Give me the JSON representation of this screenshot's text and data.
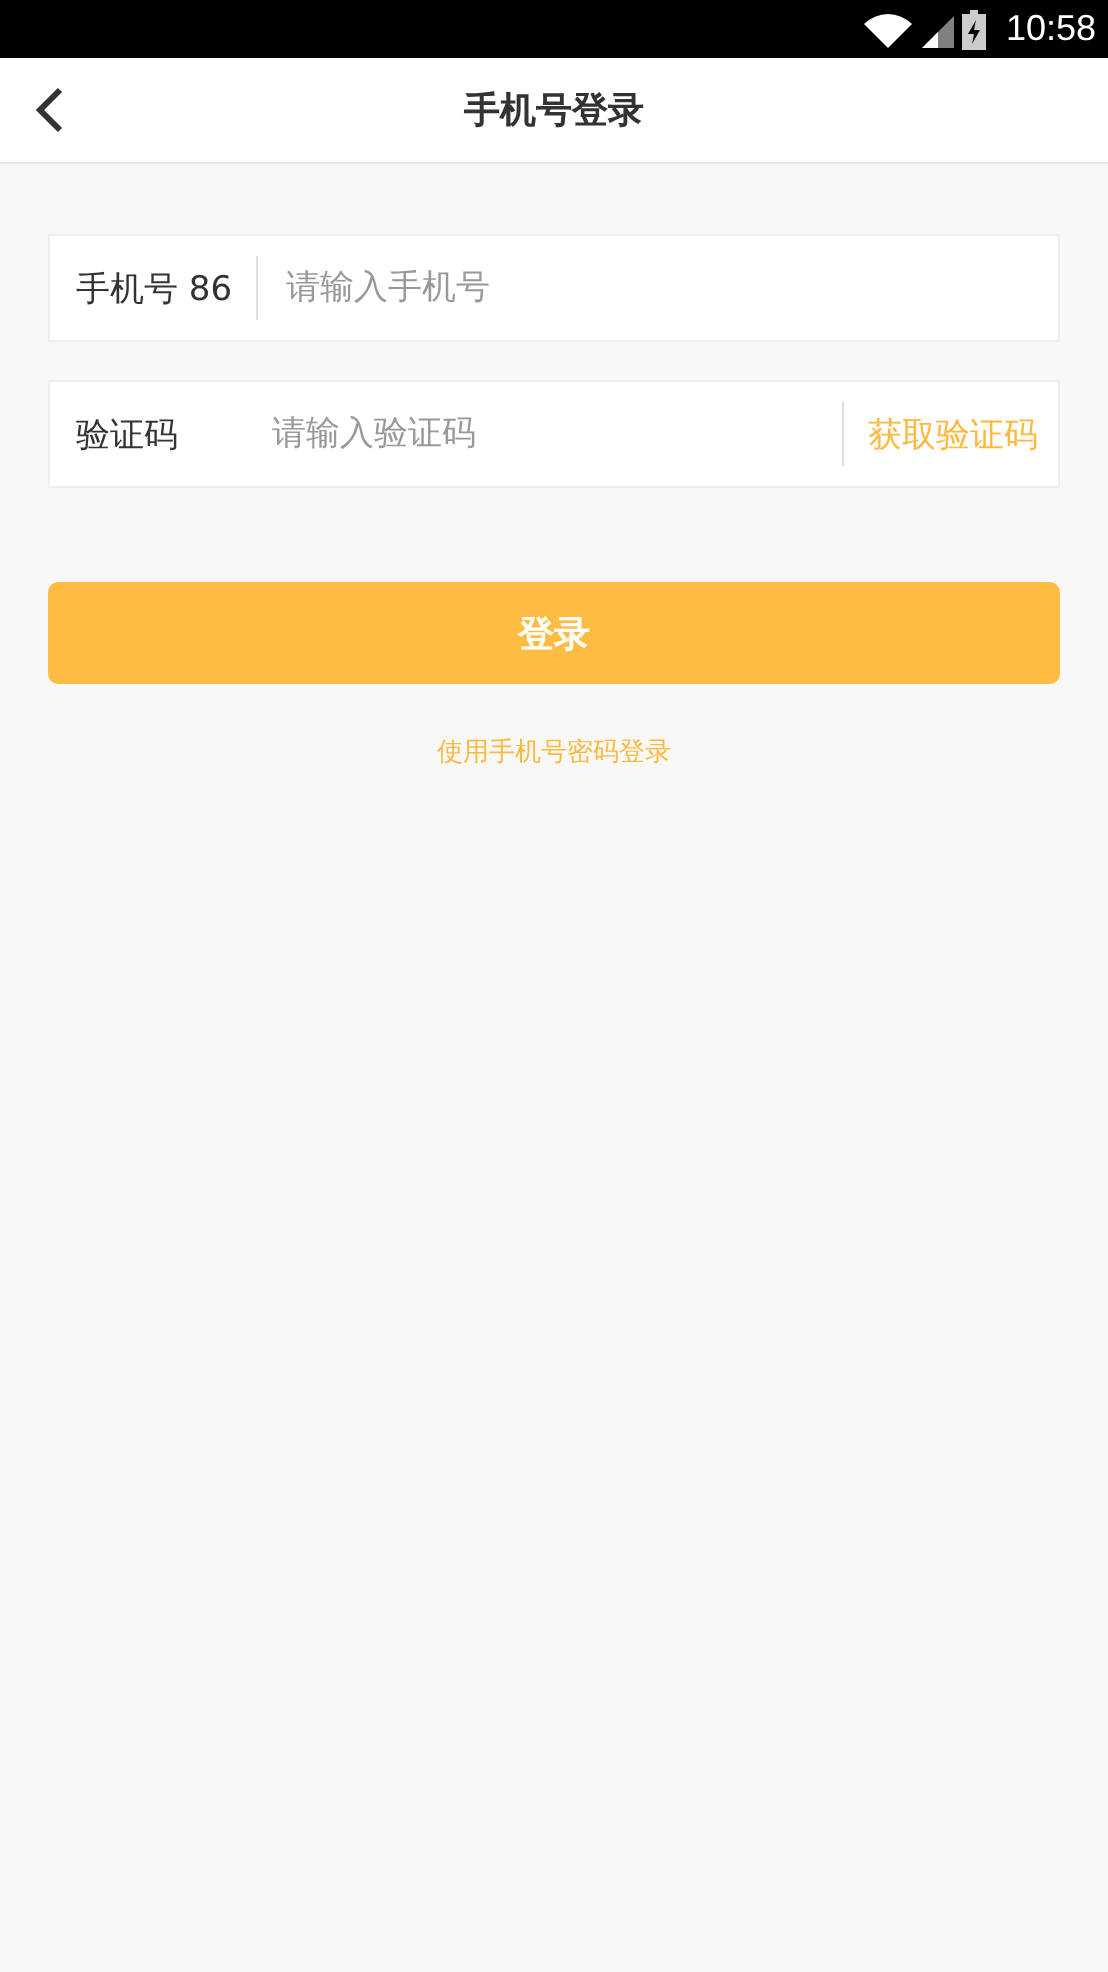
{
  "status_bar": {
    "time": "10:58"
  },
  "header": {
    "title": "手机号登录"
  },
  "fields": [
    {
      "kind": "phone",
      "label": "手机号",
      "prefix": "86",
      "placeholder": "请输入手机号"
    },
    {
      "kind": "code",
      "label": "验证码",
      "placeholder": "请输入验证码",
      "action": "获取验证码"
    }
  ],
  "login_button": "登录",
  "alt_link": "使用手机号密码登录"
}
